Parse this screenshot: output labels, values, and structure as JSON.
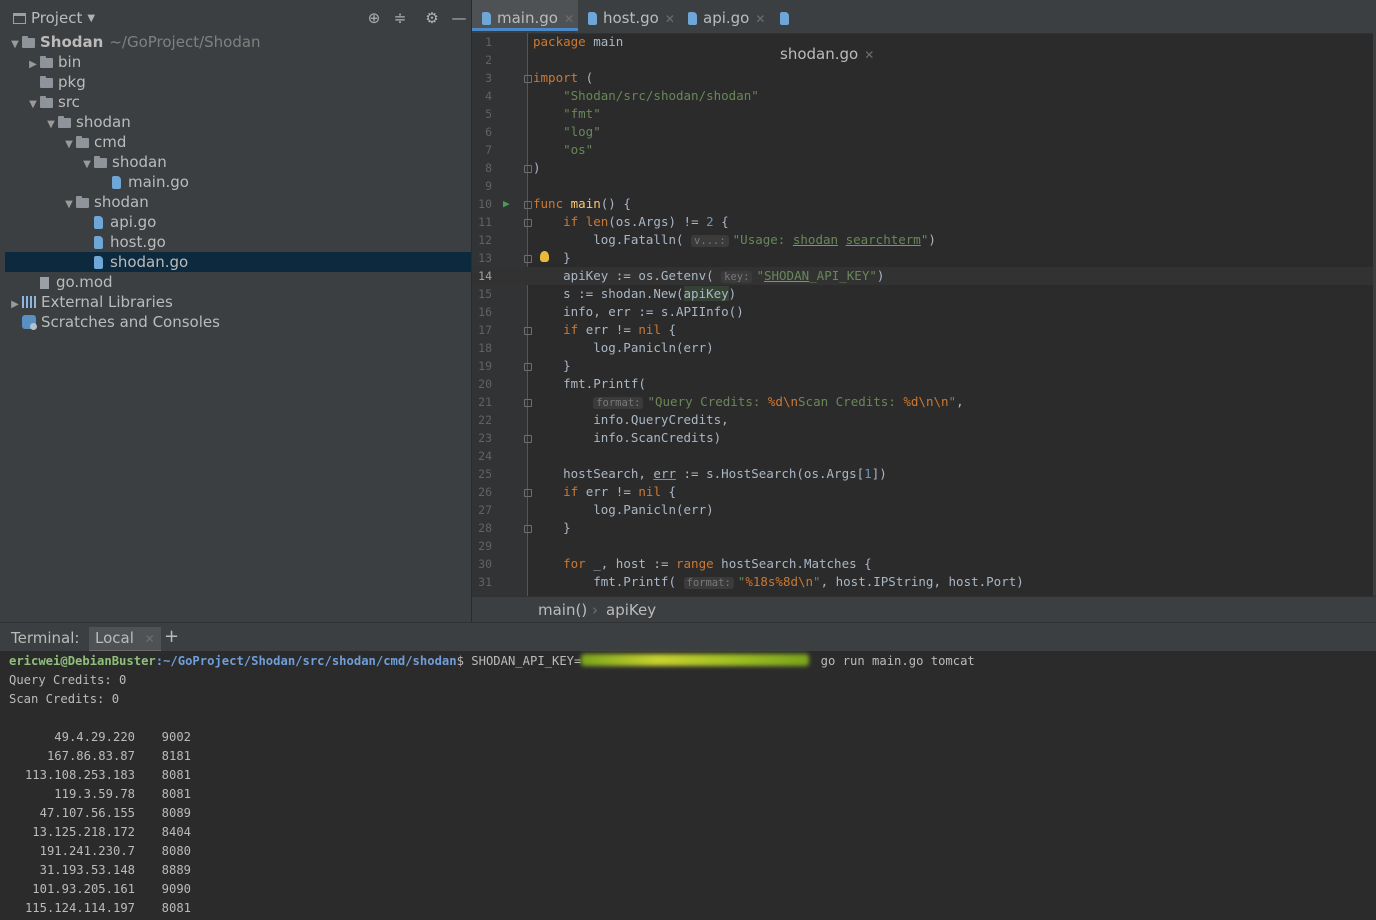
{
  "project": {
    "title": "Project",
    "tree": [
      {
        "label": "Shodan",
        "hint": "~/GoProject/Shodan",
        "kind": "folder",
        "depth": 0,
        "arrow": "down",
        "bold": true
      },
      {
        "label": "bin",
        "kind": "folder",
        "depth": 1,
        "arrow": "right"
      },
      {
        "label": "pkg",
        "kind": "folder",
        "depth": 1,
        "arrow": ""
      },
      {
        "label": "src",
        "kind": "folder",
        "depth": 1,
        "arrow": "down"
      },
      {
        "label": "shodan",
        "kind": "folder",
        "depth": 2,
        "arrow": "down"
      },
      {
        "label": "cmd",
        "kind": "folder",
        "depth": 3,
        "arrow": "down"
      },
      {
        "label": "shodan",
        "kind": "folder",
        "depth": 4,
        "arrow": "down"
      },
      {
        "label": "main.go",
        "kind": "go",
        "depth": 5,
        "arrow": ""
      },
      {
        "label": "shodan",
        "kind": "folder",
        "depth": 3,
        "arrow": "down"
      },
      {
        "label": "api.go",
        "kind": "go",
        "depth": 4,
        "arrow": ""
      },
      {
        "label": "host.go",
        "kind": "go",
        "depth": 4,
        "arrow": ""
      },
      {
        "label": "shodan.go",
        "kind": "go",
        "depth": 4,
        "arrow": "",
        "selected": true
      },
      {
        "label": "go.mod",
        "kind": "mod",
        "depth": 1,
        "arrow": ""
      },
      {
        "label": "External Libraries",
        "kind": "libs",
        "depth": 0,
        "arrow": "right"
      },
      {
        "label": "Scratches and Consoles",
        "kind": "scratch",
        "depth": 0,
        "arrow": ""
      }
    ]
  },
  "editor": {
    "tabs": [
      {
        "label": "main.go",
        "active": true
      },
      {
        "label": "host.go",
        "active": false
      },
      {
        "label": "api.go",
        "active": false
      },
      {
        "label": "shodan.go",
        "active": false
      }
    ],
    "current_line": 14,
    "code_lines": [
      "<span class=\"kw\">package</span> main",
      "",
      "<span class=\"kw\">import</span> (",
      "    <span class=\"str\">\"Shodan/src/shodan/shodan\"</span>",
      "    <span class=\"str\">\"fmt\"</span>",
      "    <span class=\"str\">\"log\"</span>",
      "    <span class=\"str\">\"os\"</span>",
      ")",
      "",
      "<span class=\"kw\">func</span> <span class=\"fn\">main</span>() {",
      "    <span class=\"kw\">if</span> <span class=\"kw\">len</span>(os.Args) != <span class=\"num\">2</span> {",
      "        log.Fatalln( <span class=\"hint\">v...:</span><span class=\"str\">\"Usage: <span class=\"ul\">shodan</span> <span class=\"ul\">searchterm</span>\"</span>)",
      "    }",
      "    apiKey := os.Getenv( <span class=\"hint\">key:</span><span class=\"str\">\"<span class=\"ul\">SHODAN</span>_API_KEY\"</span>)",
      "    s := shodan.New(<span class=\"ref\">apiKey</span>)",
      "    info, err := s.APIInfo()",
      "    <span class=\"kw\">if</span> err != <span class=\"kw\">nil</span> {",
      "        log.Panicln(err)",
      "    }",
      "    fmt.Printf(",
      "        <span class=\"hint\">format:</span><span class=\"str\">\"Query Credits: <span class=\"esc\">%d\\n</span>Scan Credits: <span class=\"esc\">%d\\n\\n</span>\"</span>,",
      "        info.QueryCredits,",
      "        info.ScanCredits)",
      "",
      "    hostSearch, <span class=\"ul\">err</span> := s.HostSearch(os.Args[<span class=\"num\">1</span>])",
      "    <span class=\"kw\">if</span> err != <span class=\"kw\">nil</span> {",
      "        log.Panicln(err)",
      "    }",
      "",
      "    <span class=\"kw\">for</span> _, host := <span class=\"kw\">range</span> hostSearch.Matches {",
      "        fmt.Printf( <span class=\"hint\">format:</span><span class=\"str\">\"<span class=\"esc\">%18s%8d\\n</span>\"</span>, host.IPString, host.Port)"
    ],
    "folds": [
      3,
      8,
      10,
      11,
      13,
      17,
      19,
      21,
      23,
      26,
      28
    ],
    "run_line": 10,
    "bulb_line": 13,
    "breadcrumb": [
      "main()",
      "apiKey"
    ],
    "breadcrumb_sep": "›"
  },
  "terminal": {
    "label": "Terminal:",
    "tab": "Local",
    "add": "+",
    "prompt_user": "ericwei@DebianBuster",
    "prompt_path": ":~/GoProject/Shodan/src/shodan/cmd/shodan",
    "prompt_sym": "$ ",
    "cmd_prefix": "SHODAN_API_KEY=",
    "cmd_suffix": " go run main.go tomcat",
    "query_credits": "Query Credits: 0",
    "scan_credits": "Scan Credits: 0",
    "results": [
      {
        "ip": "49.4.29.220",
        "port": "9002"
      },
      {
        "ip": "167.86.83.87",
        "port": "8181"
      },
      {
        "ip": "113.108.253.183",
        "port": "8081"
      },
      {
        "ip": "119.3.59.78",
        "port": "8081"
      },
      {
        "ip": "47.107.56.155",
        "port": "8089"
      },
      {
        "ip": "13.125.218.172",
        "port": "8404"
      },
      {
        "ip": "191.241.230.7",
        "port": "8080"
      },
      {
        "ip": "31.193.53.148",
        "port": "8889"
      },
      {
        "ip": "101.93.205.161",
        "port": "9090"
      },
      {
        "ip": "115.124.114.197",
        "port": "8081"
      }
    ]
  }
}
